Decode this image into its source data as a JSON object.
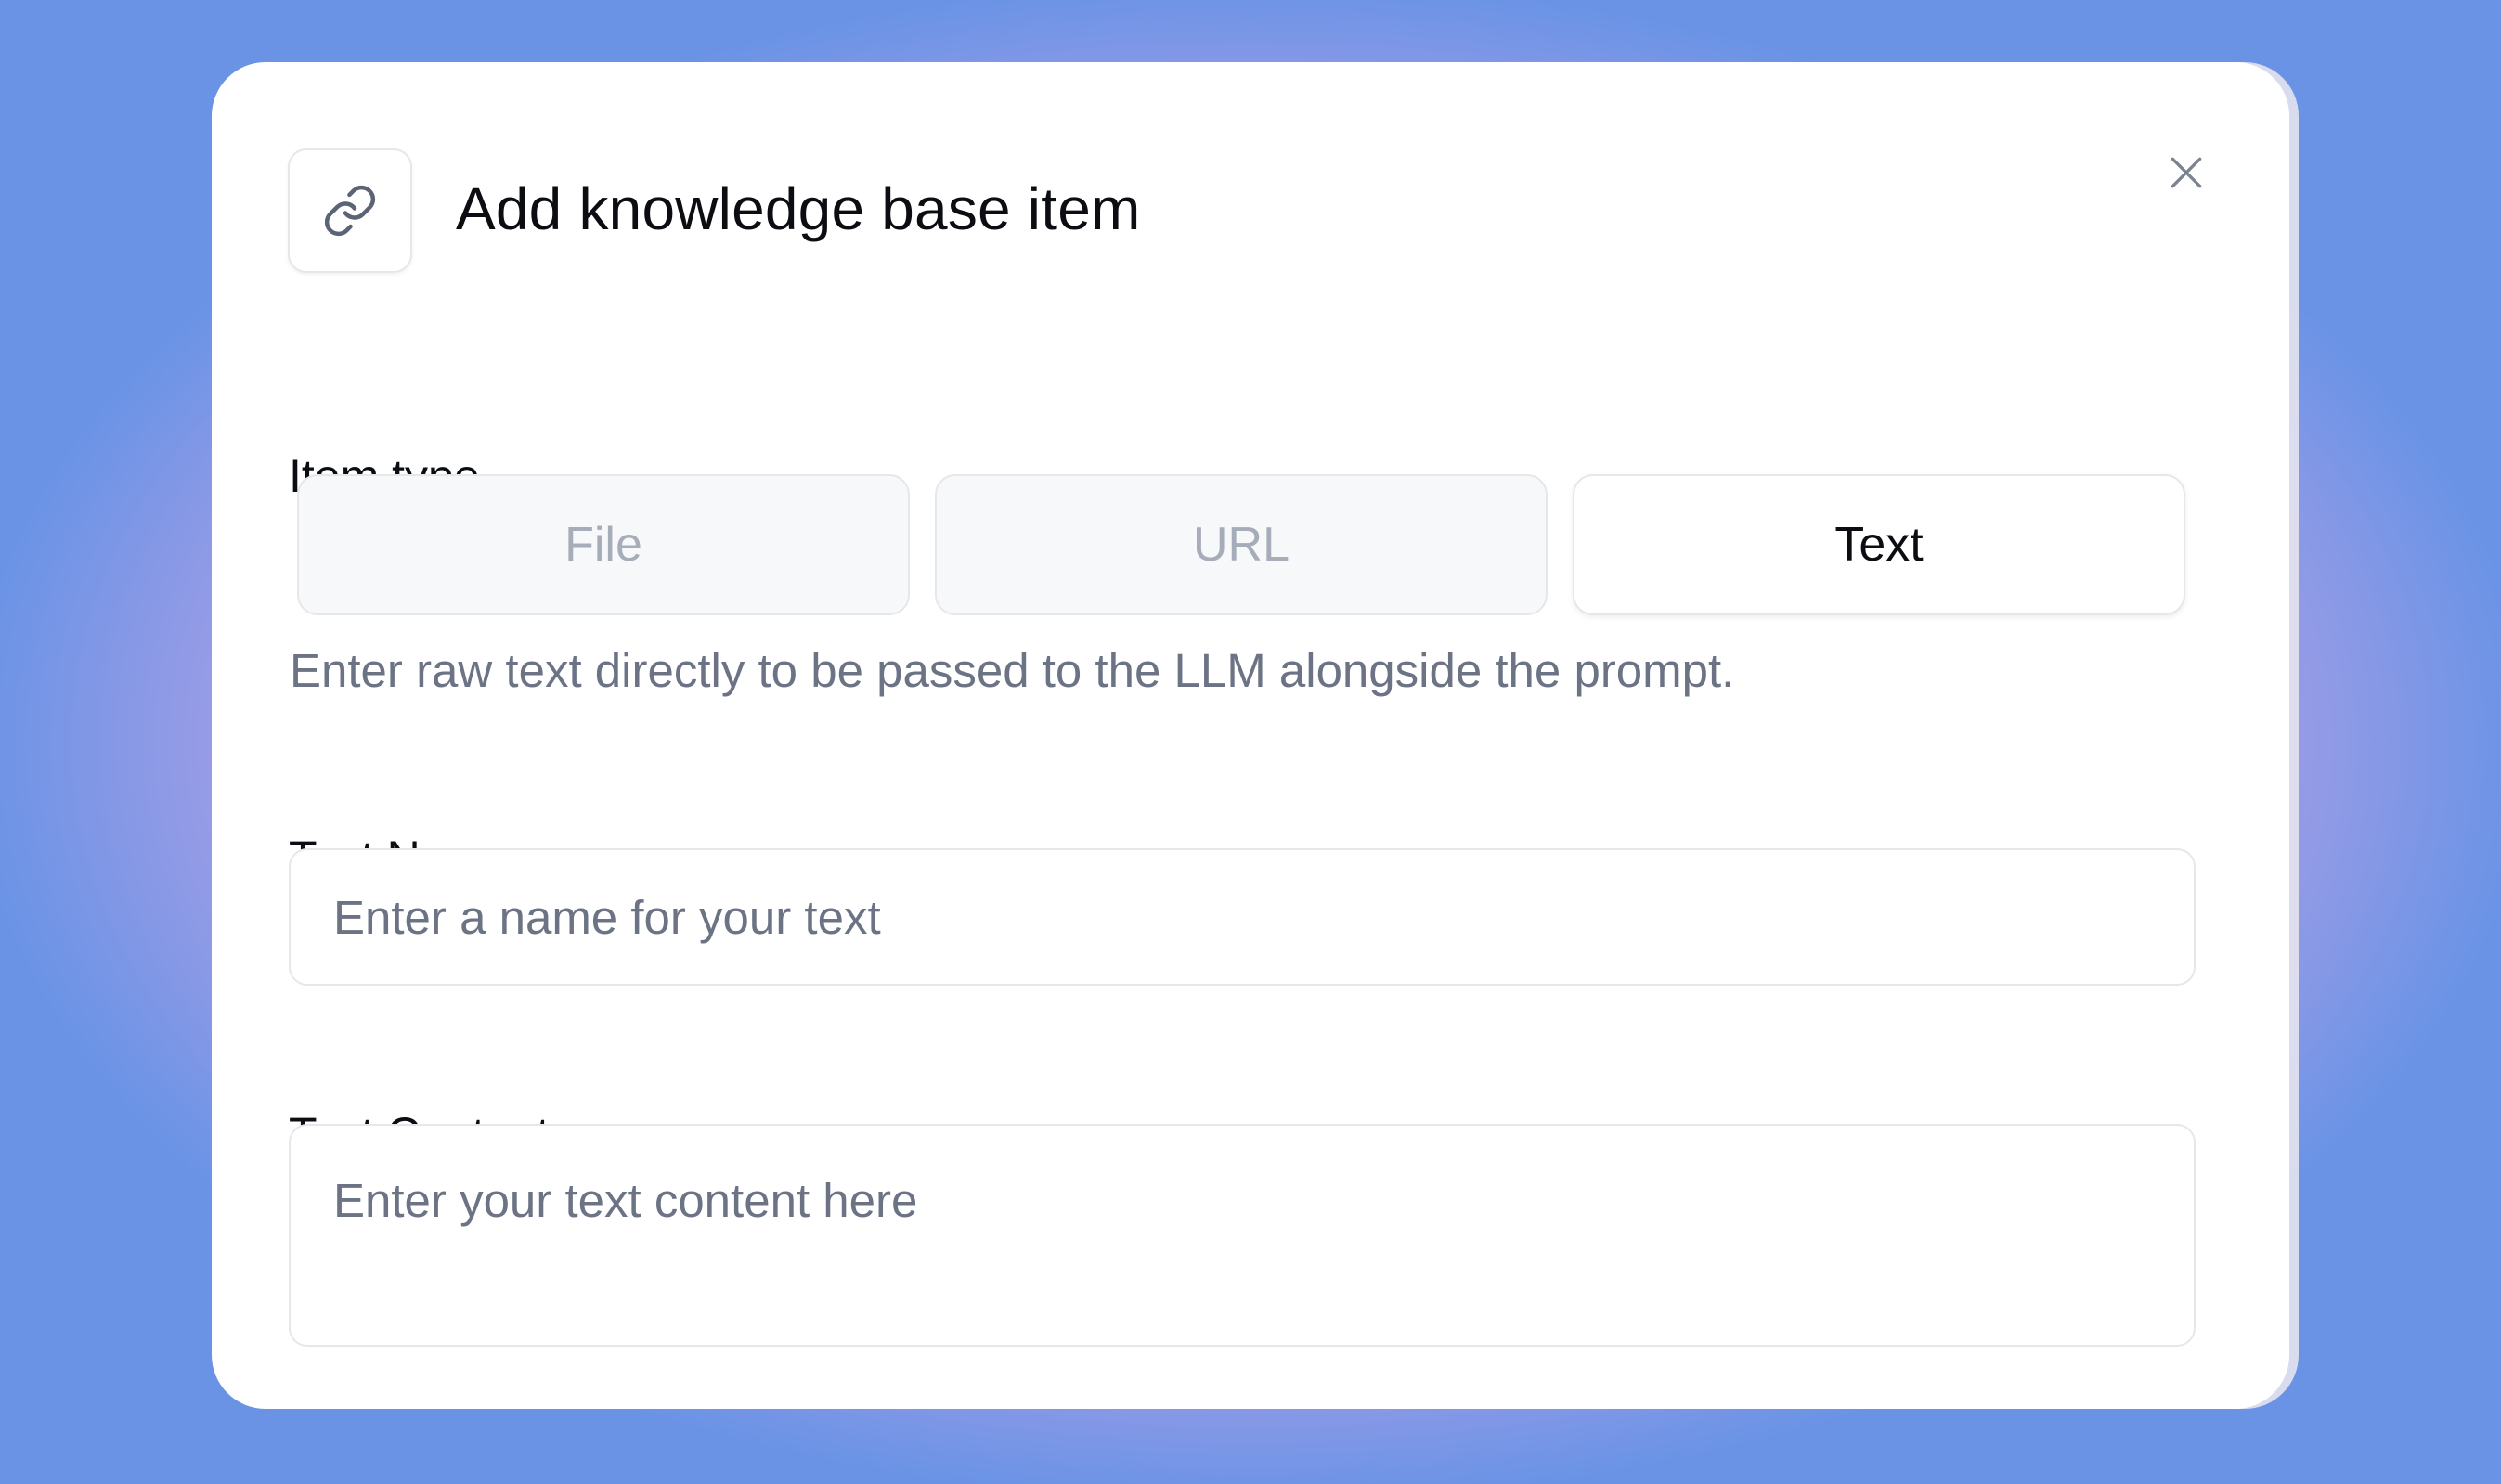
{
  "modal": {
    "title": "Add knowledge base item",
    "header_icon": "link-icon",
    "close_icon": "close-icon"
  },
  "item_type": {
    "label": "Item type",
    "options": [
      "File",
      "URL",
      "Text"
    ],
    "selected": "Text",
    "help_text": "Enter raw text directly to be passed to the LLM alongside the prompt."
  },
  "text_name": {
    "label": "Text Name",
    "value": "",
    "placeholder": "Enter a name for your text"
  },
  "text_content": {
    "label": "Text Content",
    "value": "",
    "placeholder": "Enter your text content here"
  },
  "colors": {
    "background": "#6a93e6",
    "glow": "#e2a3d6",
    "modal": "#ffffff",
    "muted_text": "#6b7385"
  }
}
